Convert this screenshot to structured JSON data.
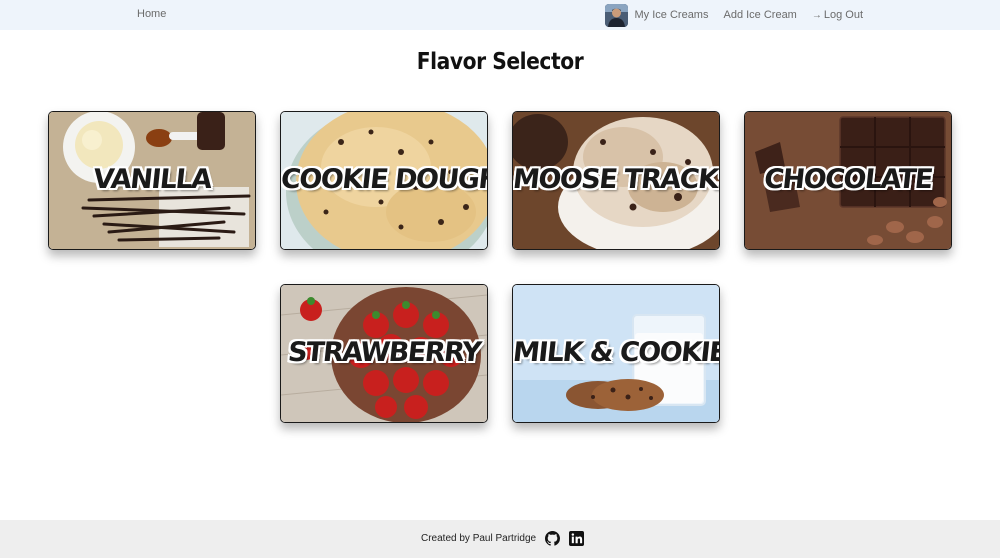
{
  "nav": {
    "home": "Home",
    "my_ice_creams": "My Ice Creams",
    "add_ice_cream": "Add Ice Cream",
    "logout_arrow": "→",
    "logout": "Log Out"
  },
  "page": {
    "title": "Flavor Selector"
  },
  "flavors": [
    {
      "name": "Vanilla"
    },
    {
      "name": "Cookie Dough"
    },
    {
      "name": "Moose Tracks"
    },
    {
      "name": "Chocolate"
    },
    {
      "name": "Strawberry"
    },
    {
      "name": "Milk & Cookies"
    }
  ],
  "footer": {
    "credit": "Created by Paul Partridge",
    "icons": [
      "github-icon",
      "linkedin-icon"
    ]
  },
  "colors": {
    "navbar_bg": "#eef4fb",
    "footer_bg": "#eeeeee",
    "nav_text": "#6b6b6b"
  }
}
